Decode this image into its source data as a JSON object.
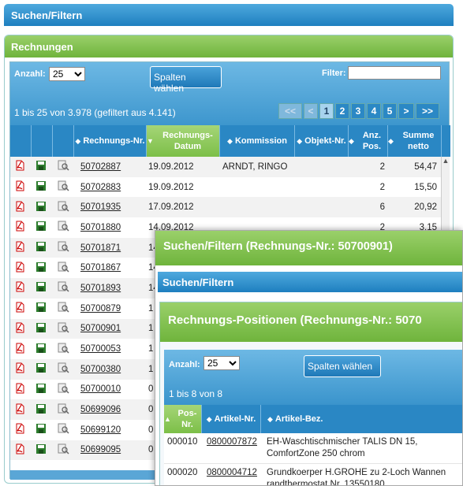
{
  "top_bar": {
    "title": "Suchen/Filtern"
  },
  "rechnungen": {
    "title": "Rechnungen",
    "anzahl_label": "Anzahl:",
    "anzahl_value": "25",
    "spalten_button": "Spalten wählen",
    "filter_label": "Filter:",
    "filter_value": "",
    "info": "1 bis 25 von 3.978 (gefiltert aus 4.141)",
    "pager": {
      "first": "<<",
      "prev": "<",
      "pages": [
        "1",
        "2",
        "3",
        "4",
        "5"
      ],
      "current": "1",
      "next": ">",
      "last": ">>"
    },
    "columns": [
      "Rechnungs-Nr.",
      "Rechnungs-Datum",
      "Kommission",
      "Objekt-Nr.",
      "Anz. Pos.",
      "Summe netto"
    ],
    "rows": [
      {
        "nr": "50702887",
        "datum": "19.09.2012",
        "kommission": "ARNDT, RINGO",
        "objekt": "",
        "anz": "2",
        "summe": "54,47"
      },
      {
        "nr": "50702883",
        "datum": "19.09.2012",
        "kommission": "",
        "objekt": "",
        "anz": "2",
        "summe": "15,50"
      },
      {
        "nr": "50701935",
        "datum": "17.09.2012",
        "kommission": "",
        "objekt": "",
        "anz": "6",
        "summe": "20,92"
      },
      {
        "nr": "50701880",
        "datum": "14.09.2012",
        "kommission": "",
        "objekt": "",
        "anz": "2",
        "summe": "3,15"
      },
      {
        "nr": "50701871",
        "datum": "14",
        "kommission": "",
        "objekt": "",
        "anz": "",
        "summe": ""
      },
      {
        "nr": "50701867",
        "datum": "14",
        "kommission": "",
        "objekt": "",
        "anz": "",
        "summe": ""
      },
      {
        "nr": "50701893",
        "datum": "14",
        "kommission": "",
        "objekt": "",
        "anz": "",
        "summe": ""
      },
      {
        "nr": "50700879",
        "datum": "1",
        "kommission": "",
        "objekt": "",
        "anz": "",
        "summe": ""
      },
      {
        "nr": "50700901",
        "datum": "1",
        "kommission": "",
        "objekt": "",
        "anz": "",
        "summe": ""
      },
      {
        "nr": "50700053",
        "datum": "1",
        "kommission": "",
        "objekt": "",
        "anz": "",
        "summe": ""
      },
      {
        "nr": "50700380",
        "datum": "1",
        "kommission": "",
        "objekt": "",
        "anz": "",
        "summe": ""
      },
      {
        "nr": "50700010",
        "datum": "0",
        "kommission": "",
        "objekt": "",
        "anz": "",
        "summe": ""
      },
      {
        "nr": "50699096",
        "datum": "0",
        "kommission": "",
        "objekt": "",
        "anz": "",
        "summe": ""
      },
      {
        "nr": "50699120",
        "datum": "0",
        "kommission": "",
        "objekt": "",
        "anz": "",
        "summe": ""
      },
      {
        "nr": "50699095",
        "datum": "0",
        "kommission": "",
        "objekt": "",
        "anz": "",
        "summe": ""
      }
    ]
  },
  "overlay": {
    "title": "Suchen/Filtern (Rechnungs-Nr.: 50700901)",
    "search_bar": "Suchen/Filtern",
    "positions_title": "Rechnungs-Positionen (Rechnungs-Nr.: 5070",
    "anzahl_label": "Anzahl:",
    "anzahl_value": "25",
    "spalten_button": "Spalten wählen",
    "info": "1 bis 8 von 8",
    "columns": [
      "Pos-Nr.",
      "Artikel-Nr.",
      "Artikel-Bez."
    ],
    "rows": [
      {
        "pos": "000010",
        "artikel": "0800007872",
        "bez1": "EH-Waschtischmischer TALIS DN 15,",
        "bez2": "ComfortZone 250 chrom"
      },
      {
        "pos": "000020",
        "artikel": "0800004712",
        "bez1": "Grundkoerper H.GROHE zu 2-Loch Wannen",
        "bez2": "randthermostat  Nr. 13550180"
      }
    ]
  },
  "colors": {
    "blue": "#1e7fbf",
    "green": "#6fb43c"
  }
}
